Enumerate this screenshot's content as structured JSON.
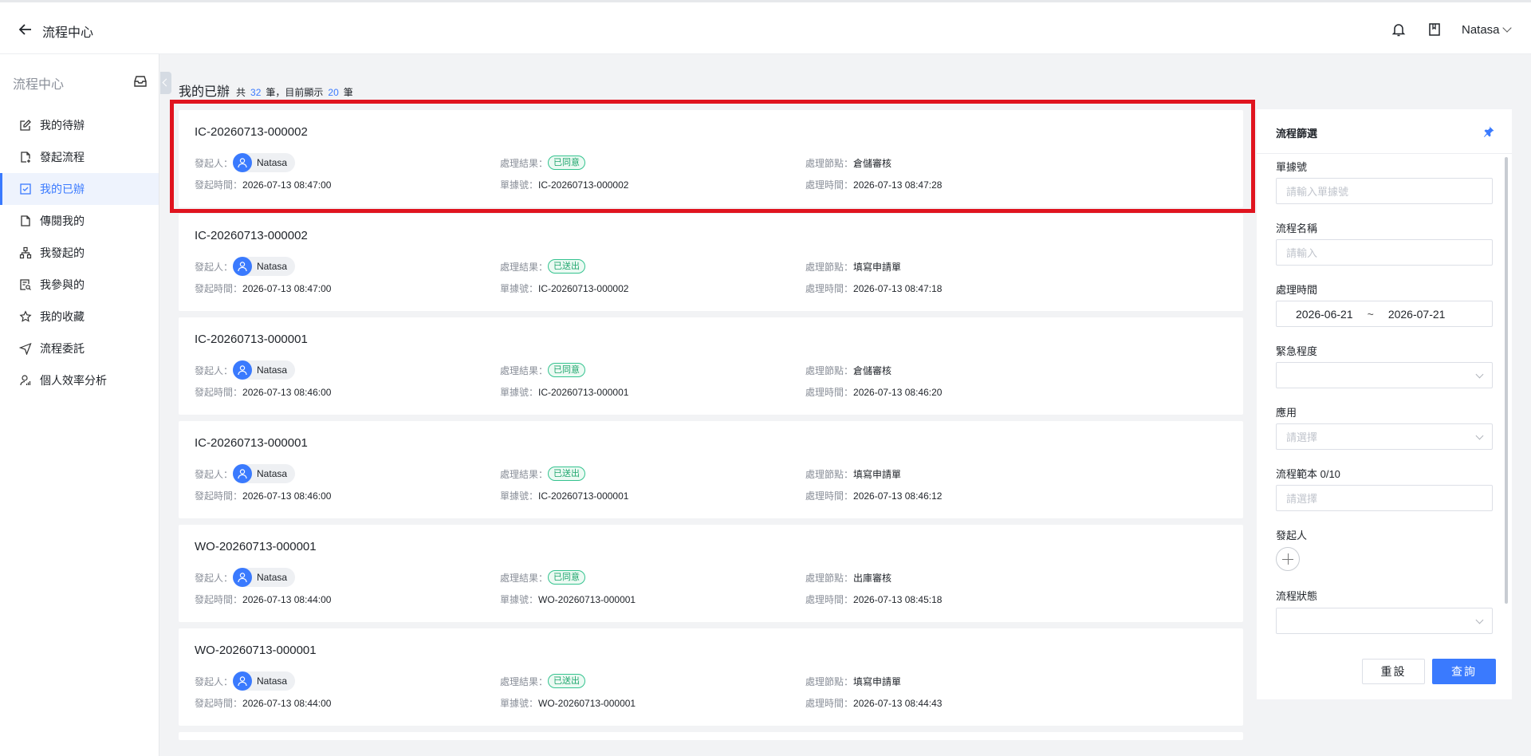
{
  "header": {
    "title": "流程中心",
    "user": "Natasa"
  },
  "sidebar": {
    "title": "流程中心",
    "items": [
      {
        "label": "我的待辦",
        "icon": "edit-icon"
      },
      {
        "label": "發起流程",
        "icon": "file-add-icon"
      },
      {
        "label": "我的已辦",
        "icon": "check-square-icon",
        "active": true
      },
      {
        "label": "傳閱我的",
        "icon": "file-icon"
      },
      {
        "label": "我發起的",
        "icon": "sitemap-icon"
      },
      {
        "label": "我參與的",
        "icon": "file-search-icon"
      },
      {
        "label": "我的收藏",
        "icon": "star-icon"
      },
      {
        "label": "流程委託",
        "icon": "send-icon"
      },
      {
        "label": "個人效率分析",
        "icon": "user-chart-icon"
      }
    ]
  },
  "main": {
    "title": "我的已辦",
    "count_prefix": "共",
    "total": "32",
    "count_mid": "筆，目前顯示",
    "shown": "20",
    "count_suffix": "筆"
  },
  "labels": {
    "initiator": "發起人：",
    "result": "處理結果：",
    "node": "處理節點：",
    "start_time": "發起時間：",
    "doc_no": "單據號：",
    "handle_time": "處理時間："
  },
  "cards": [
    {
      "id": "IC-20260713-000002",
      "initiator": "Natasa",
      "result": "已同意",
      "node": "倉儲審核",
      "start_time": "2026-07-13 08:47:00",
      "doc_no": "IC-20260713-000002",
      "handle_time": "2026-07-13 08:47:28"
    },
    {
      "id": "IC-20260713-000002",
      "initiator": "Natasa",
      "result": "已送出",
      "node": "填寫申請單",
      "start_time": "2026-07-13 08:47:00",
      "doc_no": "IC-20260713-000002",
      "handle_time": "2026-07-13 08:47:18"
    },
    {
      "id": "IC-20260713-000001",
      "initiator": "Natasa",
      "result": "已同意",
      "node": "倉儲審核",
      "start_time": "2026-07-13 08:46:00",
      "doc_no": "IC-20260713-000001",
      "handle_time": "2026-07-13 08:46:20"
    },
    {
      "id": "IC-20260713-000001",
      "initiator": "Natasa",
      "result": "已送出",
      "node": "填寫申請單",
      "start_time": "2026-07-13 08:46:00",
      "doc_no": "IC-20260713-000001",
      "handle_time": "2026-07-13 08:46:12"
    },
    {
      "id": "WO-20260713-000001",
      "initiator": "Natasa",
      "result": "已同意",
      "node": "出庫審核",
      "start_time": "2026-07-13 08:44:00",
      "doc_no": "WO-20260713-000001",
      "handle_time": "2026-07-13 08:45:18"
    },
    {
      "id": "WO-20260713-000001",
      "initiator": "Natasa",
      "result": "已送出",
      "node": "填寫申請單",
      "start_time": "2026-07-13 08:44:00",
      "doc_no": "WO-20260713-000001",
      "handle_time": "2026-07-13 08:44:43"
    }
  ],
  "filter": {
    "title": "流程篩選",
    "doc_no_label": "單據號",
    "doc_no_placeholder": "請輸入單據號",
    "flow_name_label": "流程名稱",
    "flow_name_placeholder": "請輸入",
    "handle_time_label": "處理時間",
    "date_from": "2026-06-21",
    "date_sep": "~",
    "date_to": "2026-07-21",
    "urgency_label": "緊急程度",
    "app_label": "應用",
    "app_placeholder": "請選擇",
    "template_label": "流程範本 0/10",
    "template_placeholder": "請選擇",
    "initiator_label": "發起人",
    "status_label": "流程狀態",
    "reset": "重設",
    "search": "查詢"
  },
  "colors": {
    "accent": "#3a7afe",
    "highlight": "#e0141f",
    "success": "#20a66e"
  }
}
